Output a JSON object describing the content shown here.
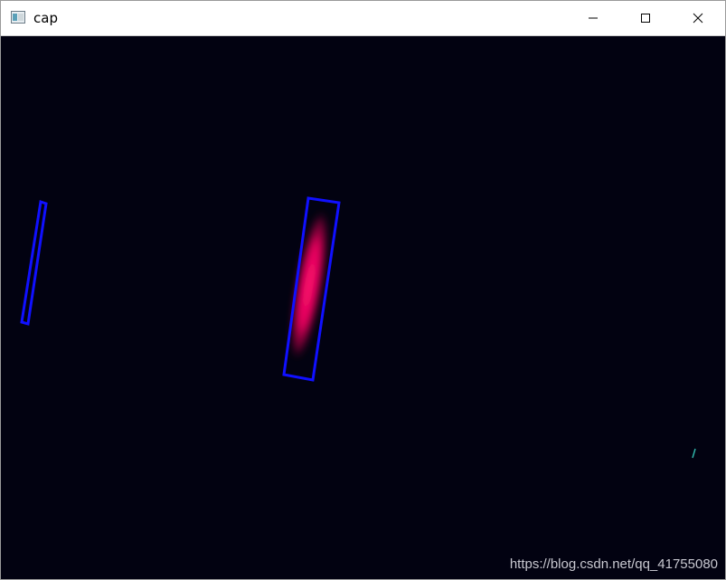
{
  "window": {
    "title": "cap",
    "controls": {
      "minimize": "minimize",
      "maximize": "maximize",
      "close": "close"
    }
  },
  "canvas": {
    "background": "#020211",
    "box_color": "#1010ff",
    "blob_color": "#e0005a"
  },
  "watermark": "https://blog.csdn.net/qq_41755080"
}
